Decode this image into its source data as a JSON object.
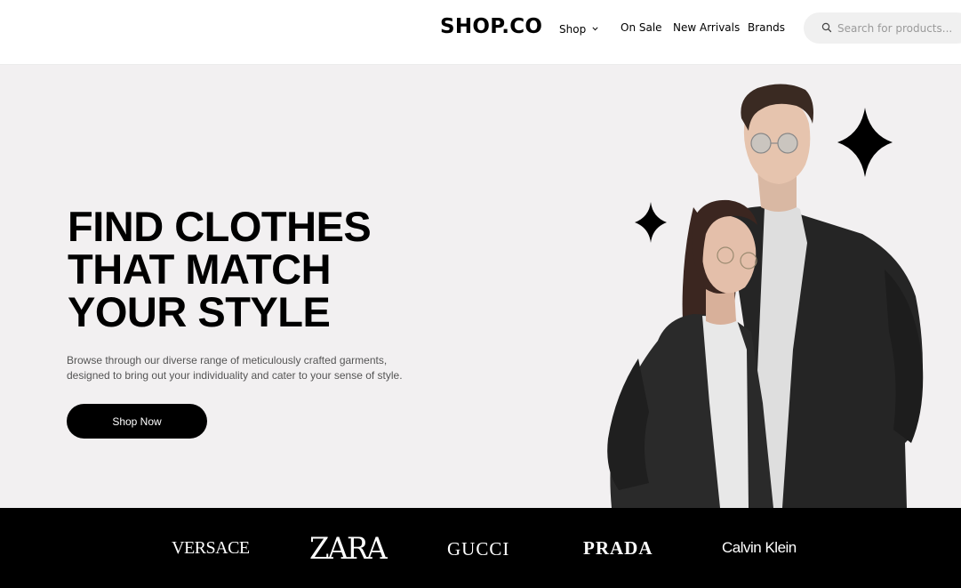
{
  "header": {
    "logo": "SHOP.CO",
    "nav": {
      "shop": "Shop",
      "on_sale": "On Sale",
      "new_arrivals": "New Arrivals",
      "brands": "Brands"
    },
    "search": {
      "placeholder": "Search for products..."
    }
  },
  "hero": {
    "title_lines": [
      "FIND CLOTHES",
      "THAT MATCH",
      "YOUR STYLE"
    ],
    "subtitle_lines": [
      "Browse through our diverse range of meticulously crafted garments,",
      "designed to bring out your individuality and cater to your sense of style."
    ],
    "cta_label": "Shop Now"
  },
  "brands": {
    "items": [
      "VERSACE",
      "ZARA",
      "GUCCI",
      "PRADA",
      "Calvin Klein"
    ]
  },
  "icons": {
    "search": "search-icon",
    "dropdown": "chevron-down-icon",
    "sparkle": "sparkle-icon"
  },
  "colors": {
    "hero_bg": "#f2f0f1",
    "primary": "#000000",
    "brands_bar_bg": "#000000",
    "search_bg": "#f0f0f0"
  }
}
